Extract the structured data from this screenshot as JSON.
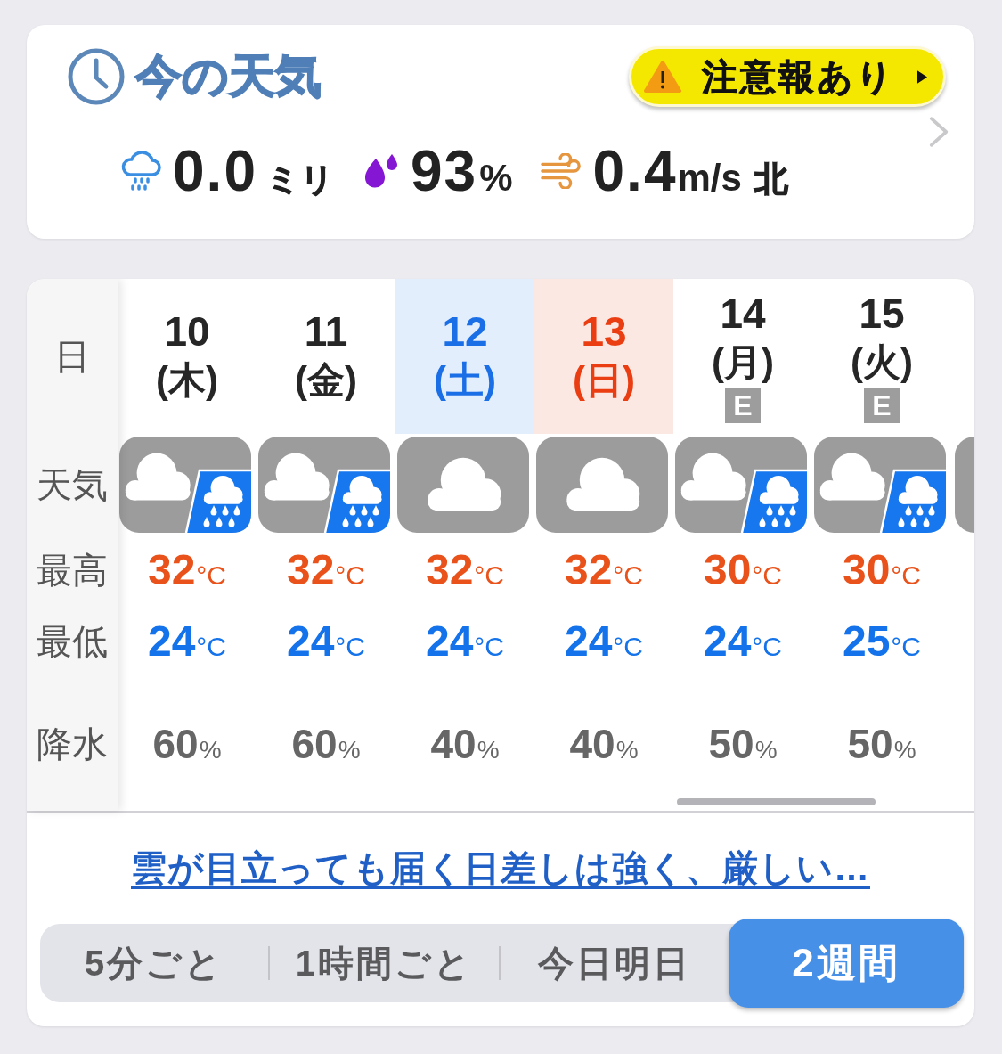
{
  "current": {
    "title": "今の天気",
    "warning": {
      "label": "注意報あり"
    },
    "readings": [
      {
        "kind": "precipitation",
        "value": "0.0",
        "unit": "ミリ"
      },
      {
        "kind": "humidity",
        "value": "93",
        "unit": "%"
      },
      {
        "kind": "wind",
        "value": "0.4",
        "unit": "m/s",
        "direction": "北"
      }
    ]
  },
  "forecast": {
    "row_labels": [
      "日",
      "天気",
      "最高",
      "最低",
      "降水"
    ],
    "days": [
      {
        "date": "10",
        "weekday": "(木)",
        "kind": "weekday",
        "weather": {
          "kind": "cloudy_then_rain"
        },
        "high": {
          "value": "32",
          "unit": "°C"
        },
        "low": {
          "value": "24",
          "unit": "°C"
        },
        "precip": {
          "value": "60",
          "unit": "%"
        }
      },
      {
        "date": "11",
        "weekday": "(金)",
        "kind": "weekday",
        "weather": {
          "kind": "cloudy_then_rain"
        },
        "high": {
          "value": "32",
          "unit": "°C"
        },
        "low": {
          "value": "24",
          "unit": "°C"
        },
        "precip": {
          "value": "60",
          "unit": "%"
        }
      },
      {
        "date": "12",
        "weekday": "(土)",
        "kind": "saturday",
        "weather": {
          "kind": "cloudy"
        },
        "high": {
          "value": "32",
          "unit": "°C"
        },
        "low": {
          "value": "24",
          "unit": "°C"
        },
        "precip": {
          "value": "40",
          "unit": "%"
        }
      },
      {
        "date": "13",
        "weekday": "(日)",
        "kind": "sunday",
        "weather": {
          "kind": "cloudy"
        },
        "high": {
          "value": "32",
          "unit": "°C"
        },
        "low": {
          "value": "24",
          "unit": "°C"
        },
        "precip": {
          "value": "40",
          "unit": "%"
        }
      },
      {
        "date": "14",
        "weekday": "(月)",
        "kind": "weekday",
        "badge": "E",
        "weather": {
          "kind": "cloudy_then_rain"
        },
        "high": {
          "value": "30",
          "unit": "°C"
        },
        "low": {
          "value": "24",
          "unit": "°C"
        },
        "precip": {
          "value": "50",
          "unit": "%"
        }
      },
      {
        "date": "15",
        "weekday": "(火)",
        "kind": "weekday",
        "badge": "E",
        "weather": {
          "kind": "cloudy_then_rain"
        },
        "high": {
          "value": "30",
          "unit": "°C"
        },
        "low": {
          "value": "25",
          "unit": "°C"
        },
        "precip": {
          "value": "50",
          "unit": "%"
        }
      }
    ],
    "summary_link": "雲が目立っても届く日差しは強く、厳しい…"
  },
  "tabs": [
    {
      "label": "5分ごと",
      "selected": false
    },
    {
      "label": "1時間ごと",
      "selected": false
    },
    {
      "label": "今日明日",
      "selected": false
    },
    {
      "label": "2週間",
      "selected": true
    }
  ]
}
